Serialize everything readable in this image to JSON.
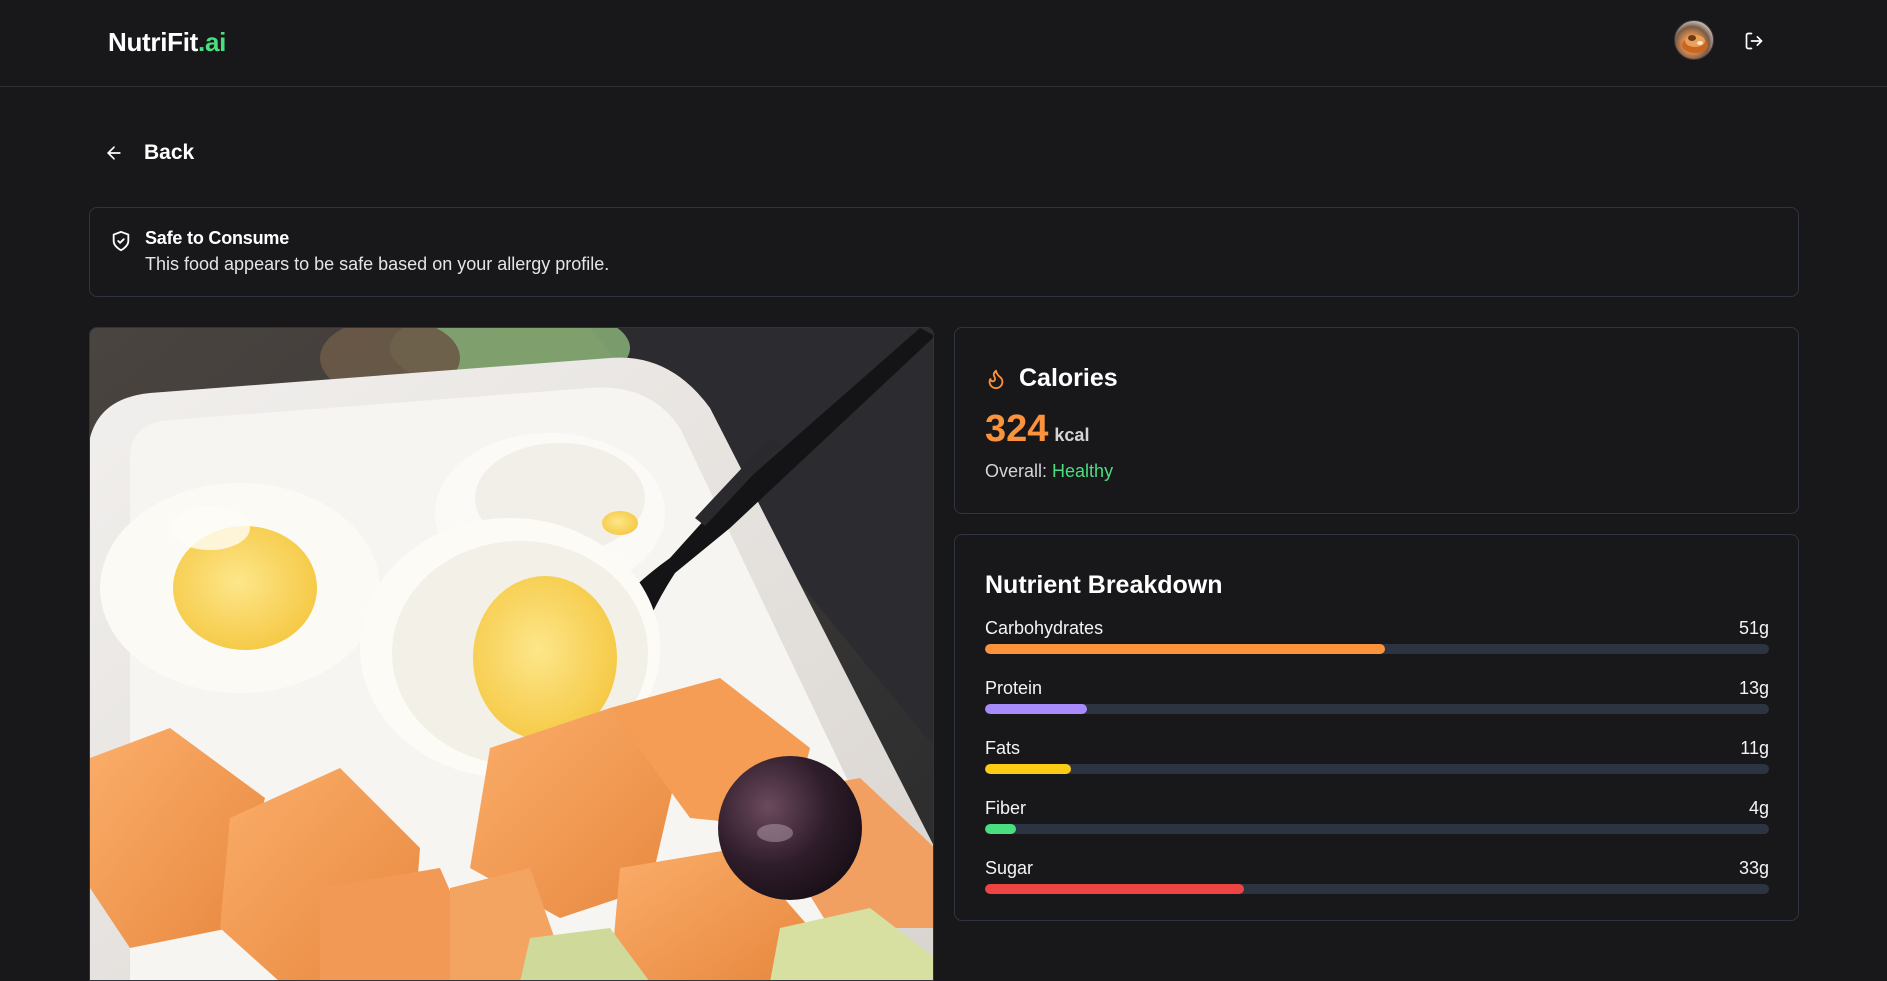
{
  "header": {
    "brand_main": "NutriFit",
    "brand_accent": ".ai",
    "avatar_alt": "User avatar",
    "logout_icon": "logout-icon"
  },
  "nav": {
    "back_label": "Back",
    "back_icon": "arrow-left-icon"
  },
  "alert": {
    "icon": "shield-check-icon",
    "title": "Safe to Consume",
    "description": "This food appears to be safe based on your allergy profile."
  },
  "calories": {
    "icon": "flame-icon",
    "title": "Calories",
    "value": "324",
    "unit": "kcal",
    "overall_label": "Overall:",
    "overall_status": "Healthy"
  },
  "nutrients": {
    "title": "Nutrient Breakdown",
    "items": [
      {
        "name": "Carbohydrates",
        "amount": "51g",
        "fraction": 0.51,
        "color": "#fb923c"
      },
      {
        "name": "Protein",
        "amount": "13g",
        "fraction": 0.13,
        "color": "#a78bfa"
      },
      {
        "name": "Fats",
        "amount": "11g",
        "fraction": 0.11,
        "color": "#facc15"
      },
      {
        "name": "Fiber",
        "amount": "4g",
        "fraction": 0.04,
        "color": "#4ade80"
      },
      {
        "name": "Sugar",
        "amount": "33g",
        "fraction": 0.33,
        "color": "#ef4444"
      }
    ]
  },
  "colors": {
    "background": "#18181b",
    "border": "#2f3441",
    "accent_green": "#4ade80",
    "accent_orange": "#fb923c",
    "track": "#2d3441"
  }
}
